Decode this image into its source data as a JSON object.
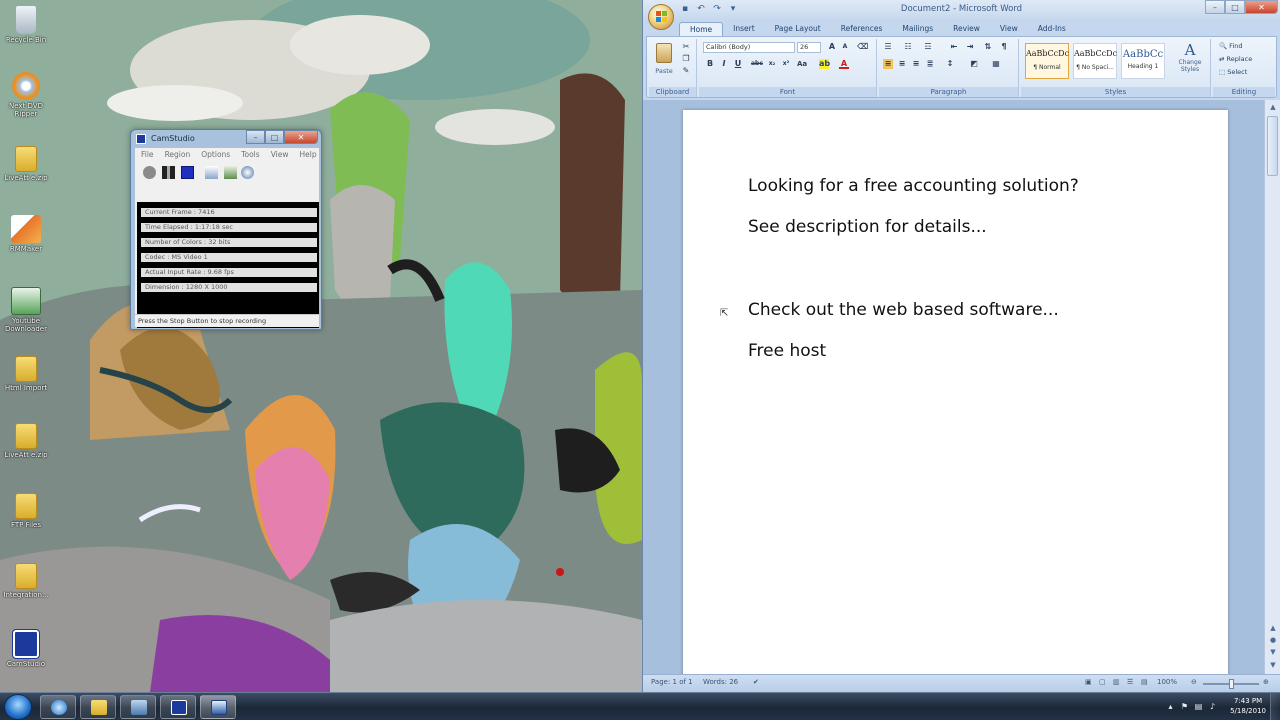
{
  "desktop": {
    "icons": [
      {
        "label": "Recycle Bin",
        "icon": "recycle-bin-icon",
        "color": "#c9d3de"
      },
      {
        "label": "Next DVD Ripper",
        "icon": "dvd-ripper-icon",
        "color": "#ea8f22"
      },
      {
        "label": "LiveAtt e.zip",
        "icon": "folder-icon",
        "color": "#e6c24b"
      },
      {
        "label": "RMMaker",
        "icon": "rm-maker-icon",
        "color": "#e8762a"
      },
      {
        "label": "Youtube Downloader",
        "icon": "downloader-icon",
        "color": "#58a35a"
      },
      {
        "label": "Html Import",
        "icon": "folder-icon",
        "color": "#e6c24b"
      },
      {
        "label": "LiveAtt e.zip",
        "icon": "zip-folder-icon",
        "color": "#e6c24b"
      },
      {
        "label": "FTP Files",
        "icon": "folder-icon",
        "color": "#e6c24b"
      },
      {
        "label": "Integration...",
        "icon": "folder-icon",
        "color": "#e6c24b"
      },
      {
        "label": "CamStudio",
        "icon": "camstudio-icon",
        "color": "#1b3a9c"
      }
    ]
  },
  "camstudio": {
    "title": "CamStudio",
    "menu": [
      "File",
      "Region",
      "Options",
      "Tools",
      "View",
      "Help"
    ],
    "stats": [
      "Current Frame : 7416",
      "Time Elapsed : 1:17:18 sec",
      "Number of Colors : 32 bits",
      "Codec : MS Video 1",
      "Actual Input Rate : 9.68 fps",
      "Dimension : 1280 X 1000"
    ],
    "status": "Press the Stop Button to stop recording"
  },
  "word": {
    "title": "Document2 - Microsoft Word",
    "tabs": [
      "Home",
      "Insert",
      "Page Layout",
      "References",
      "Mailings",
      "Review",
      "View",
      "Add-Ins"
    ],
    "font_name": "Calibri (Body)",
    "font_size": "26",
    "groups": [
      "Clipboard",
      "Font",
      "Paragraph",
      "Styles",
      "Editing"
    ],
    "paste_label": "Paste",
    "styles": [
      {
        "preview": "AaBbCcDc",
        "name": "¶ Normal"
      },
      {
        "preview": "AaBbCcDc",
        "name": "¶ No Spaci..."
      },
      {
        "preview": "AaBbCc",
        "name": "Heading 1"
      }
    ],
    "change_styles": "Change Styles",
    "editing": [
      "Find",
      "Replace",
      "Select"
    ],
    "document_lines": [
      "Looking for a free accounting solution?",
      "See description for details...",
      "Check out the web based software...",
      "Free host"
    ],
    "status_page": "Page: 1 of 1",
    "status_words": "Words: 26",
    "zoom": "100%"
  },
  "taskbar": {
    "time": "7:43 PM",
    "date": "5/18/2010"
  }
}
